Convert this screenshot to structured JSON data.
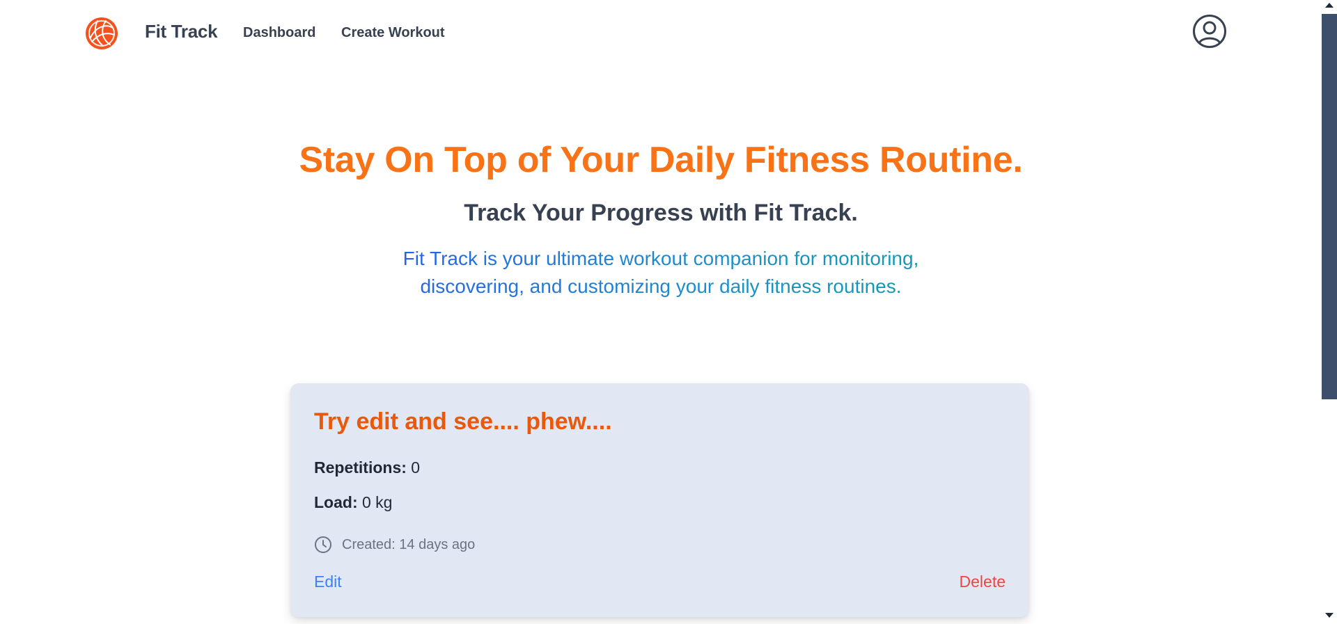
{
  "nav": {
    "brand": "Fit Track",
    "links": [
      "Dashboard",
      "Create Workout"
    ],
    "logo_icon": "globe-logo-icon",
    "profile_icon": "user-circle-icon"
  },
  "hero": {
    "title": "Stay On Top of Your Daily Fitness Routine.",
    "subtitle": "Track Your Progress with Fit Track.",
    "description": "Fit Track is your ultimate workout companion for monitoring, discovering, and customizing your daily fitness routines."
  },
  "workout": {
    "title": "Try edit and see.... phew....",
    "repetitions_label": "Repetitions:",
    "repetitions_value": "0",
    "load_label": "Load:",
    "load_value": "0 kg",
    "created": "Created: 14 days ago",
    "edit_label": "Edit",
    "delete_label": "Delete",
    "clock_icon": "clock-icon"
  },
  "colors": {
    "accent": "#f97316",
    "title_orange": "#ea580c",
    "link_blue": "#3b82f6",
    "danger": "#ef4444",
    "card_bg": "#e2e8f3",
    "text_dark": "#374151"
  }
}
